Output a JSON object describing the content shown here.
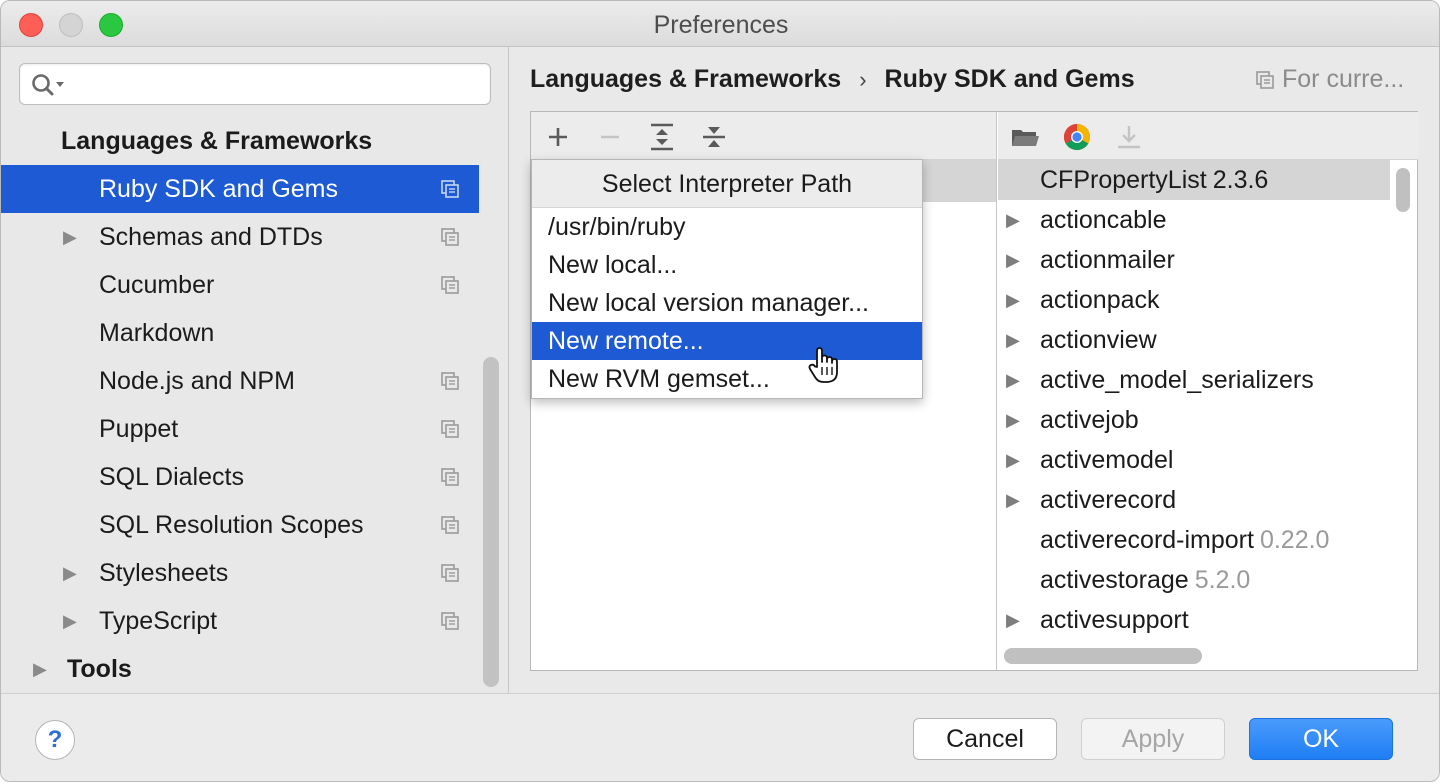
{
  "window": {
    "title": "Preferences"
  },
  "search": {
    "placeholder": "",
    "value": ""
  },
  "sidebar": {
    "items": [
      {
        "label": "Languages & Frameworks",
        "kind": "category",
        "has_arrow": false,
        "copy_icon": false,
        "selected": false
      },
      {
        "label": "Ruby SDK and Gems",
        "kind": "child",
        "has_arrow": false,
        "copy_icon": true,
        "selected": true
      },
      {
        "label": "Schemas and DTDs",
        "kind": "child",
        "has_arrow": true,
        "copy_icon": true,
        "selected": false
      },
      {
        "label": "Cucumber",
        "kind": "child",
        "has_arrow": false,
        "copy_icon": true,
        "selected": false
      },
      {
        "label": "Markdown",
        "kind": "child",
        "has_arrow": false,
        "copy_icon": false,
        "selected": false
      },
      {
        "label": "Node.js and NPM",
        "kind": "child",
        "has_arrow": false,
        "copy_icon": true,
        "selected": false
      },
      {
        "label": "Puppet",
        "kind": "child",
        "has_arrow": false,
        "copy_icon": true,
        "selected": false
      },
      {
        "label": "SQL Dialects",
        "kind": "child",
        "has_arrow": false,
        "copy_icon": true,
        "selected": false
      },
      {
        "label": "SQL Resolution Scopes",
        "kind": "child",
        "has_arrow": false,
        "copy_icon": true,
        "selected": false
      },
      {
        "label": "Stylesheets",
        "kind": "child",
        "has_arrow": true,
        "copy_icon": true,
        "selected": false
      },
      {
        "label": "TypeScript",
        "kind": "child",
        "has_arrow": true,
        "copy_icon": true,
        "selected": false
      },
      {
        "label": "Tools",
        "kind": "top",
        "has_arrow": true,
        "copy_icon": false,
        "selected": false
      }
    ]
  },
  "breadcrumb": {
    "parent": "Languages & Frameworks",
    "separator": "›",
    "current": "Ruby SDK and Gems"
  },
  "scope_label": "For curre...",
  "sdk_toolbar": {
    "icons": [
      "add-icon",
      "remove-icon",
      "expand-all-icon",
      "collapse-all-icon"
    ]
  },
  "gems_toolbar": {
    "icons": [
      "open-folder-icon",
      "chrome-icon",
      "download-icon"
    ]
  },
  "popup": {
    "title": "Select Interpreter Path",
    "items": [
      {
        "label": "/usr/bin/ruby",
        "highlighted": false
      },
      {
        "label": "New local...",
        "highlighted": false
      },
      {
        "label": "New local version manager...",
        "highlighted": false
      },
      {
        "label": "New remote...",
        "highlighted": true
      },
      {
        "label": "New RVM gemset...",
        "highlighted": false
      }
    ]
  },
  "gems": [
    {
      "name": "CFPropertyList",
      "version": "2.3.6",
      "has_arrow": false,
      "selected": true,
      "version_muted": false
    },
    {
      "name": "actioncable",
      "version": "",
      "has_arrow": true,
      "selected": false,
      "version_muted": true
    },
    {
      "name": "actionmailer",
      "version": "",
      "has_arrow": true,
      "selected": false,
      "version_muted": true
    },
    {
      "name": "actionpack",
      "version": "",
      "has_arrow": true,
      "selected": false,
      "version_muted": true
    },
    {
      "name": "actionview",
      "version": "",
      "has_arrow": true,
      "selected": false,
      "version_muted": true
    },
    {
      "name": "active_model_serializers",
      "version": "",
      "has_arrow": true,
      "selected": false,
      "version_muted": true
    },
    {
      "name": "activejob",
      "version": "",
      "has_arrow": true,
      "selected": false,
      "version_muted": true
    },
    {
      "name": "activemodel",
      "version": "",
      "has_arrow": true,
      "selected": false,
      "version_muted": true
    },
    {
      "name": "activerecord",
      "version": "",
      "has_arrow": true,
      "selected": false,
      "version_muted": true
    },
    {
      "name": "activerecord-import",
      "version": "0.22.0",
      "has_arrow": false,
      "selected": false,
      "version_muted": true
    },
    {
      "name": "activestorage",
      "version": "5.2.0",
      "has_arrow": false,
      "selected": false,
      "version_muted": true
    },
    {
      "name": "activesupport",
      "version": "",
      "has_arrow": true,
      "selected": false,
      "version_muted": true
    }
  ],
  "footer": {
    "help_label": "?",
    "cancel_label": "Cancel",
    "apply_label": "Apply",
    "ok_label": "OK"
  },
  "colors": {
    "selection": "#1d5ad3",
    "ok_button": "#1f7ef5",
    "muted_text": "#9a9a9a"
  }
}
